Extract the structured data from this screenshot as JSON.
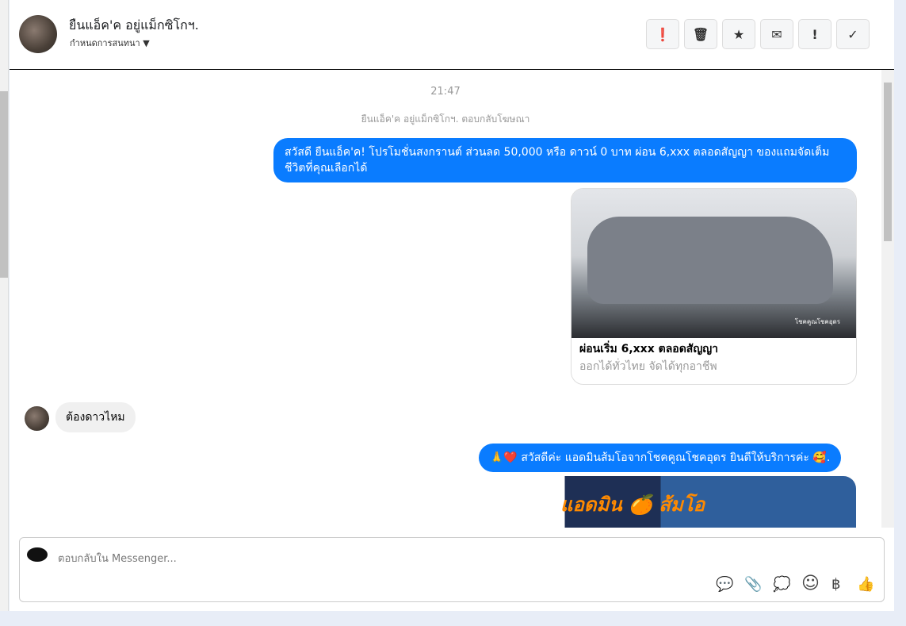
{
  "header": {
    "name": "ยืนแอ็ค'ค อยู่แม็กซิโกฯ.",
    "subtitle": "กำหนดการสนทนา",
    "toolbar": [
      {
        "icon": "alert-icon",
        "glyph": "❗"
      },
      {
        "icon": "trash-icon",
        "glyph": "🗑"
      },
      {
        "icon": "star-icon",
        "glyph": "★"
      },
      {
        "icon": "mail-icon",
        "glyph": "✉"
      },
      {
        "icon": "important-icon",
        "glyph": "!"
      },
      {
        "icon": "check-icon",
        "glyph": "✓"
      }
    ]
  },
  "chat": {
    "time": "21:47",
    "note": "ยืนแอ็ค'ค อยู่แม็กซิโกฯ. ตอบกลับโฆษณา",
    "msg1": "สวัสดี ยืนแอ็ค'ค! โปรโมชั่นสงกรานต์ ส่วนลด 50,000 หรือ ดาวน์ 0 บาท ผ่อน 6,xxx ตลอดสัญญา ของแถมจัดเต็ม ชีวิตที่คุณเลือกได้",
    "card": {
      "title": "ผ่อนเริ่ม 6,xxx ตลอดสัญญา",
      "subtitle": "ออกได้ทั่วไทย จัดได้ทุกอาชีพ",
      "image_caption": "โชคคูณโชคอุดร"
    },
    "incoming": "ต้องดาวไหม",
    "msg2": "🙏❤️ สวัสดีค่ะ แอดมินส้มโอจากโชคคูณโชคอุดร ยินดีให้บริการค่ะ 🥰.",
    "ad_text": "แอดมิน 🍊 ส้มโอ"
  },
  "composer": {
    "placeholder": "ตอบกลับใน Messenger...",
    "icons": [
      {
        "icon": "saved-reply-icon",
        "glyph": "💬"
      },
      {
        "icon": "paperclip-icon",
        "glyph": "📎"
      },
      {
        "icon": "quick-reply-icon",
        "glyph": "💭"
      },
      {
        "icon": "emoji-icon",
        "glyph": "☺"
      },
      {
        "icon": "baht-icon",
        "glyph": "฿"
      },
      {
        "icon": "thumbs-up-icon",
        "glyph": "👍"
      }
    ]
  }
}
